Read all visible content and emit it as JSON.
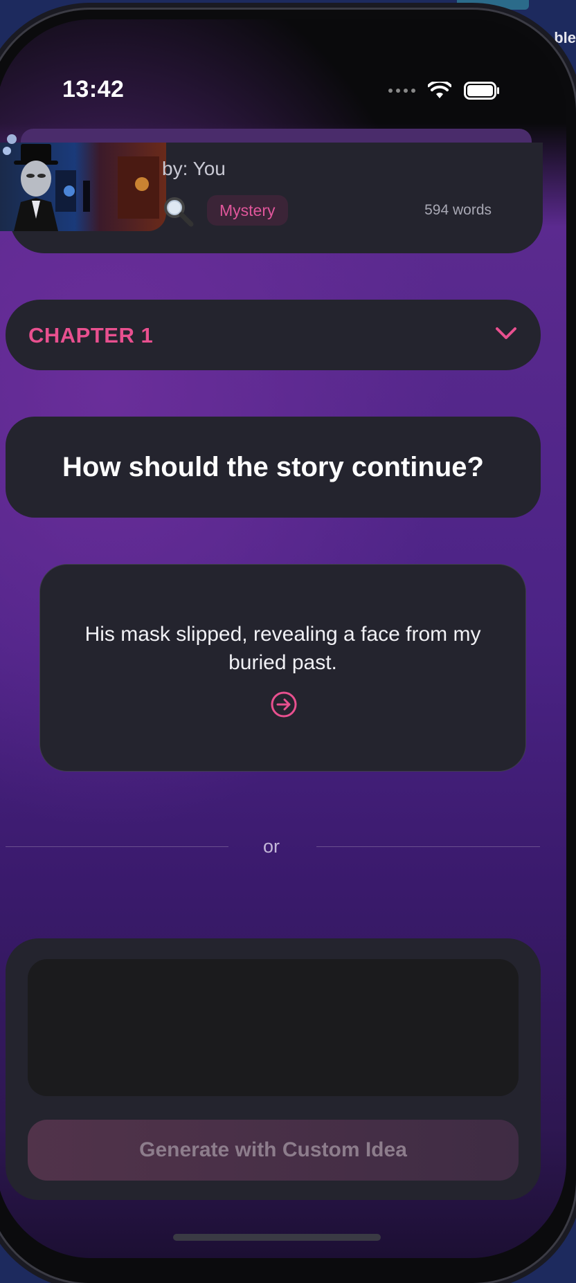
{
  "status_bar": {
    "time": "13:42"
  },
  "background_window": {
    "title_fragment": "...",
    "side_label": "ble"
  },
  "story": {
    "byline": "by: You",
    "genre": "Mystery",
    "word_count": "594 words"
  },
  "chapter": {
    "label": "CHAPTER 1"
  },
  "prompt": {
    "question": "How should the story continue?"
  },
  "option": {
    "text": "His mask slipped, revealing a face from my buried past."
  },
  "divider": {
    "label": "or"
  },
  "custom": {
    "input_value": "",
    "input_placeholder": "",
    "button_label": "Generate with Custom Idea"
  },
  "colors": {
    "accent": "#e8508f",
    "card": "#24242e",
    "input": "#1b1b1d"
  },
  "icons": [
    "wifi-icon",
    "battery-icon",
    "magnifier-icon",
    "chevron-down-icon",
    "arrow-right-circle-icon"
  ]
}
